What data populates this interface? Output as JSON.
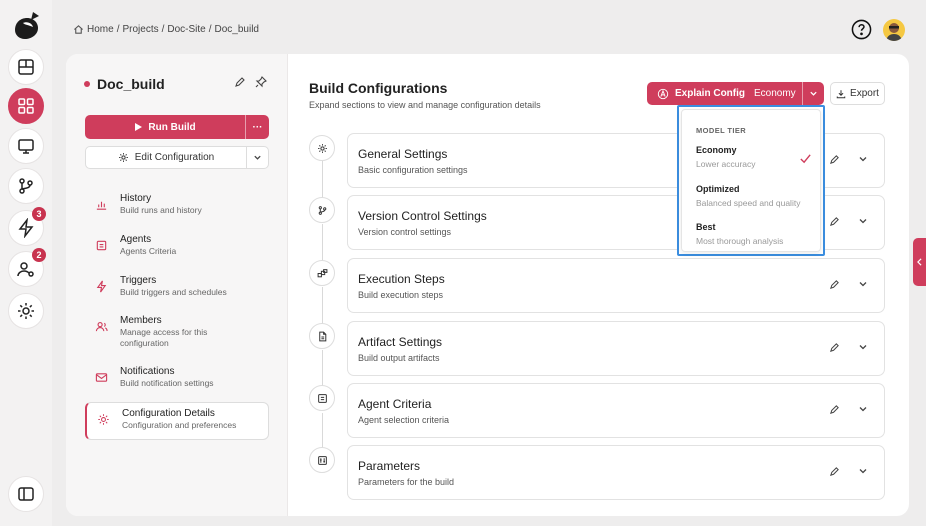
{
  "breadcrumb": {
    "items": [
      "Home",
      "Projects",
      "Doc-Site",
      "Doc_build"
    ],
    "sep": "/"
  },
  "rail": {
    "badges": {
      "triggers": "3",
      "members": "2"
    }
  },
  "panel": {
    "title": "Doc_build",
    "run_label": "Run Build",
    "run_more": "···",
    "edit_label": "Edit Configuration",
    "nav": [
      {
        "title": "History",
        "subtitle": "Build runs and history"
      },
      {
        "title": "Agents",
        "subtitle": "Agents Criteria"
      },
      {
        "title": "Triggers",
        "subtitle": "Build triggers and schedules"
      },
      {
        "title": "Members",
        "subtitle": "Manage access for this configuration"
      },
      {
        "title": "Notifications",
        "subtitle": "Build notification settings"
      },
      {
        "title": "Configuration Details",
        "subtitle": "Configuration and preferences"
      }
    ]
  },
  "main": {
    "title": "Build Configurations",
    "subtitle": "Expand sections to view and manage configuration details",
    "explain_label": "Explain Config",
    "explain_tier": "Economy",
    "export_label": "Export",
    "sections": [
      {
        "title": "General Settings",
        "subtitle": "Basic configuration settings"
      },
      {
        "title": "Version Control Settings",
        "subtitle": "Version control settings"
      },
      {
        "title": "Execution Steps",
        "subtitle": "Build execution steps"
      },
      {
        "title": "Artifact Settings",
        "subtitle": "Build output artifacts"
      },
      {
        "title": "Agent Criteria",
        "subtitle": "Agent selection criteria"
      },
      {
        "title": "Parameters",
        "subtitle": "Parameters for the build"
      }
    ]
  },
  "dropdown": {
    "header": "MODEL TIER",
    "options": [
      {
        "name": "Economy",
        "desc": "Lower accuracy",
        "selected": true
      },
      {
        "name": "Optimized",
        "desc": "Balanced speed and quality",
        "selected": false
      },
      {
        "name": "Best",
        "desc": "Most thorough analysis",
        "selected": false
      }
    ]
  },
  "colors": {
    "accent": "#cf3d5c",
    "highlight": "#3b8ee0"
  }
}
